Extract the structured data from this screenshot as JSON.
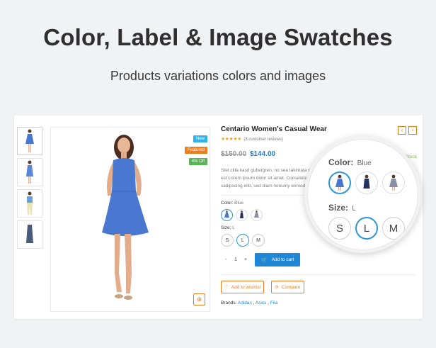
{
  "header": {
    "title": "Color, Label & Image Swatches",
    "subtitle": "Products variations colors and images"
  },
  "product": {
    "title": "Centario Women's Casual Wear",
    "rating_stars": "★★★★★",
    "reviews": "(3 customer reviews)",
    "old_price": "$150.00",
    "new_price": "$144.00",
    "description": "Stet clita kasd gubergren, no sea takimata sanctus est Lorem ipsum dolor sit amet. Consetetur sadipscing elitr, sed diam nonumy eirmod tempor invidunt ut labore et dolore magna aliquyam erat, sed diam voluptua.",
    "badges": {
      "new": "New",
      "featured": "Featured",
      "off": "4% Off"
    },
    "in_stock": "In Stock",
    "nav_prev": "‹",
    "nav_next": "›",
    "zoom_icon": "⊕",
    "color_label": "Color:",
    "color_value": "Blue",
    "size_label": "Size:",
    "size_value": "L",
    "sizes": [
      "S",
      "L",
      "M"
    ],
    "qty_minus": "-",
    "qty_value": "1",
    "qty_plus": "+",
    "add_to_cart_icon": "🛒",
    "add_to_cart": "Add to cart",
    "wishlist_icon": "♡",
    "wishlist": "Add to wishlist",
    "compare_icon": "⟳",
    "compare": "Compare",
    "brands_label": "Brands:",
    "brands": [
      "Adidas",
      "Asics",
      "Fila"
    ]
  },
  "colors": {
    "accent_blue": "#1e88d6",
    "accent_orange": "#f07d1b",
    "dress_blue": "#4a78d0",
    "dress_navy": "#23325a",
    "dress_grey": "#8b8fa5"
  }
}
